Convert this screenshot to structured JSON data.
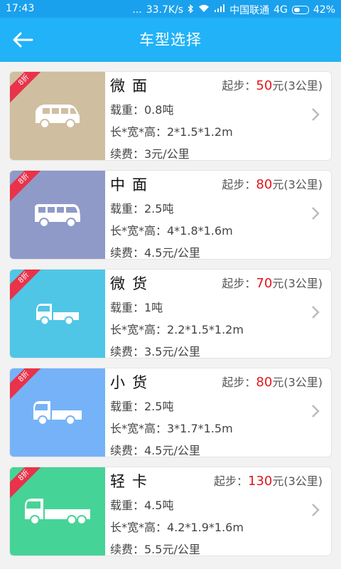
{
  "status_bar": {
    "time": "17:43",
    "dots": "...",
    "speed": "33.7K/s",
    "carrier": "中国联通",
    "network": "4G",
    "battery": "42%"
  },
  "header": {
    "title": "车型选择",
    "back_icon": "arrow-left-icon"
  },
  "vehicles": [
    {
      "name": "微面",
      "badge": "8折",
      "price_label": "起步：",
      "price": "50",
      "price_suffix": "元(3公里)",
      "load": "载重：0.8吨",
      "size": "长*宽*高：2*1.5*1.2m",
      "extra": "续费：3元/公里",
      "color": "#cfbfa0",
      "icon": "minivan-icon"
    },
    {
      "name": "中面",
      "badge": "8折",
      "price_label": "起步：",
      "price": "80",
      "price_suffix": "元(3公里)",
      "load": "载重：2.5吨",
      "size": "长*宽*高：4*1.8*1.6m",
      "extra": "续费：4.5元/公里",
      "color": "#8f9ac9",
      "icon": "van-icon"
    },
    {
      "name": "微货",
      "badge": "8折",
      "price_label": "起步：",
      "price": "70",
      "price_suffix": "元(3公里)",
      "load": "载重：1吨",
      "size": "长*宽*高：2.2*1.5*1.2m",
      "extra": "续费：3.5元/公里",
      "color": "#4fc6e6",
      "icon": "mini-truck-icon"
    },
    {
      "name": "小货",
      "badge": "8折",
      "price_label": "起步：",
      "price": "80",
      "price_suffix": "元(3公里)",
      "load": "载重：2.5吨",
      "size": "长*宽*高：3*1.7*1.5m",
      "extra": "续费：4.5元/公里",
      "color": "#76b2f8",
      "icon": "small-truck-icon"
    },
    {
      "name": "轻卡",
      "badge": "8折",
      "price_label": "起步：",
      "price": "130",
      "price_suffix": "元(3公里)",
      "load": "载重：4.5吨",
      "size": "长*宽*高：4.2*1.9*1.6m",
      "extra": "续费：5.5元/公里",
      "color": "#46d397",
      "icon": "light-truck-icon"
    }
  ],
  "colors": {
    "status_bar": "#1aa1ed",
    "header": "#21b2f7",
    "price": "#e3151b",
    "badge": "#e8334a"
  }
}
